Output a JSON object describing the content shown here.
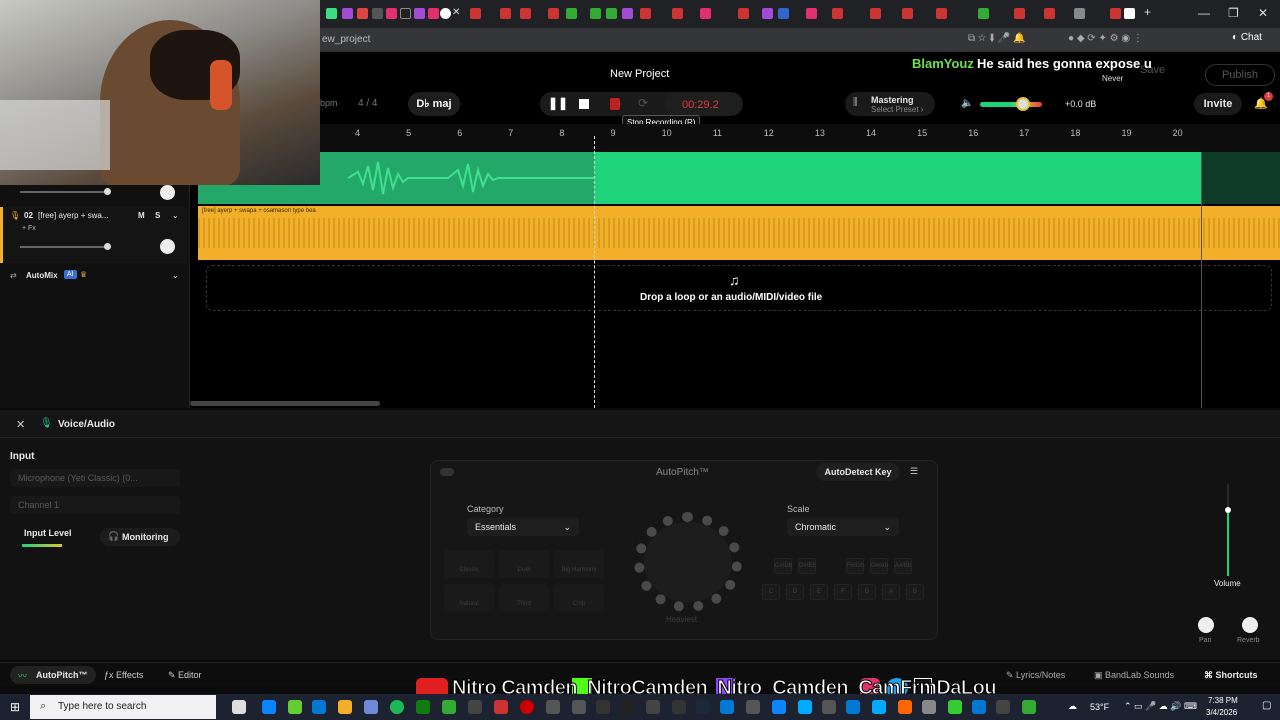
{
  "browser": {
    "url": "ew_project",
    "window_controls": [
      "—",
      "❐",
      "✕"
    ]
  },
  "header": {
    "project_title": "New Project",
    "bpm": "bpm",
    "time_signature": "4 / 4",
    "key": "D♭ maj",
    "time": "00:29.2",
    "tooltip": "Stop Recording (R)",
    "mastering_title": "Mastering",
    "mastering_sub": "Select Preset ›",
    "volume_db": "+0.0 dB",
    "invite": "Invite",
    "save": "Save",
    "publish": "Publish",
    "notification_count": "1"
  },
  "chat": {
    "user": "BlamYouz",
    "message": "He said hes gonna expose u",
    "never": "Never"
  },
  "ruler": [
    "4",
    "5",
    "6",
    "7",
    "8",
    "9",
    "10",
    "11",
    "12",
    "13",
    "14",
    "15",
    "16",
    "17",
    "18",
    "19",
    "20"
  ],
  "tracks": [
    {
      "number": "02",
      "name": "[free] ayerp + swa...",
      "mute": "M",
      "solo": "S",
      "fx": "+ Fx",
      "region_label": "[free] ayerp + swapa + osamason type bea"
    }
  ],
  "automix": {
    "label": "AutoMix",
    "badge": "AI"
  },
  "drop_zone": "Drop a loop or an audio/MIDI/video file",
  "panel": {
    "title": "Voice/Audio",
    "input_label": "Input",
    "device": "Microphone (Yeti Classic) (0...",
    "channel": "Channel 1",
    "input_level": "Input Level",
    "monitoring": "Monitoring",
    "volume": "Volume",
    "pan": "Pan",
    "reverb": "Reverb"
  },
  "autopitch": {
    "title": "AutoPitch™",
    "autodetect": "AutoDetect Key",
    "category_label": "Category",
    "category_value": "Essentials",
    "scale_label": "Scale",
    "scale_value": "Chromatic",
    "presets": [
      "Classic",
      "Duet",
      "Big Harmony",
      "Natural",
      "Third",
      "Chip"
    ],
    "dial_label": "Heaviest",
    "key_row1": [
      "C#/Db",
      "D#/Eb",
      "",
      "F#/Gb",
      "G#/Ab",
      "A#/Bb"
    ],
    "key_row2": [
      "C",
      "D",
      "E",
      "F",
      "G",
      "A",
      "B"
    ]
  },
  "footer": {
    "autopitch": "AutoPitch™",
    "effects": "Effects",
    "editor": "Editor",
    "lyrics": "Lyrics/Notes",
    "bandlab_sounds": "BandLab Sounds",
    "shortcuts": "Shortcuts"
  },
  "banner": "Nitro Camden  NitroCamden  Nitro_Camden  CamFrmDaLou",
  "taskbar": {
    "search": "Type here to search",
    "weather": "53°F",
    "time": "7:38 PM",
    "date": "3/4/2026"
  }
}
